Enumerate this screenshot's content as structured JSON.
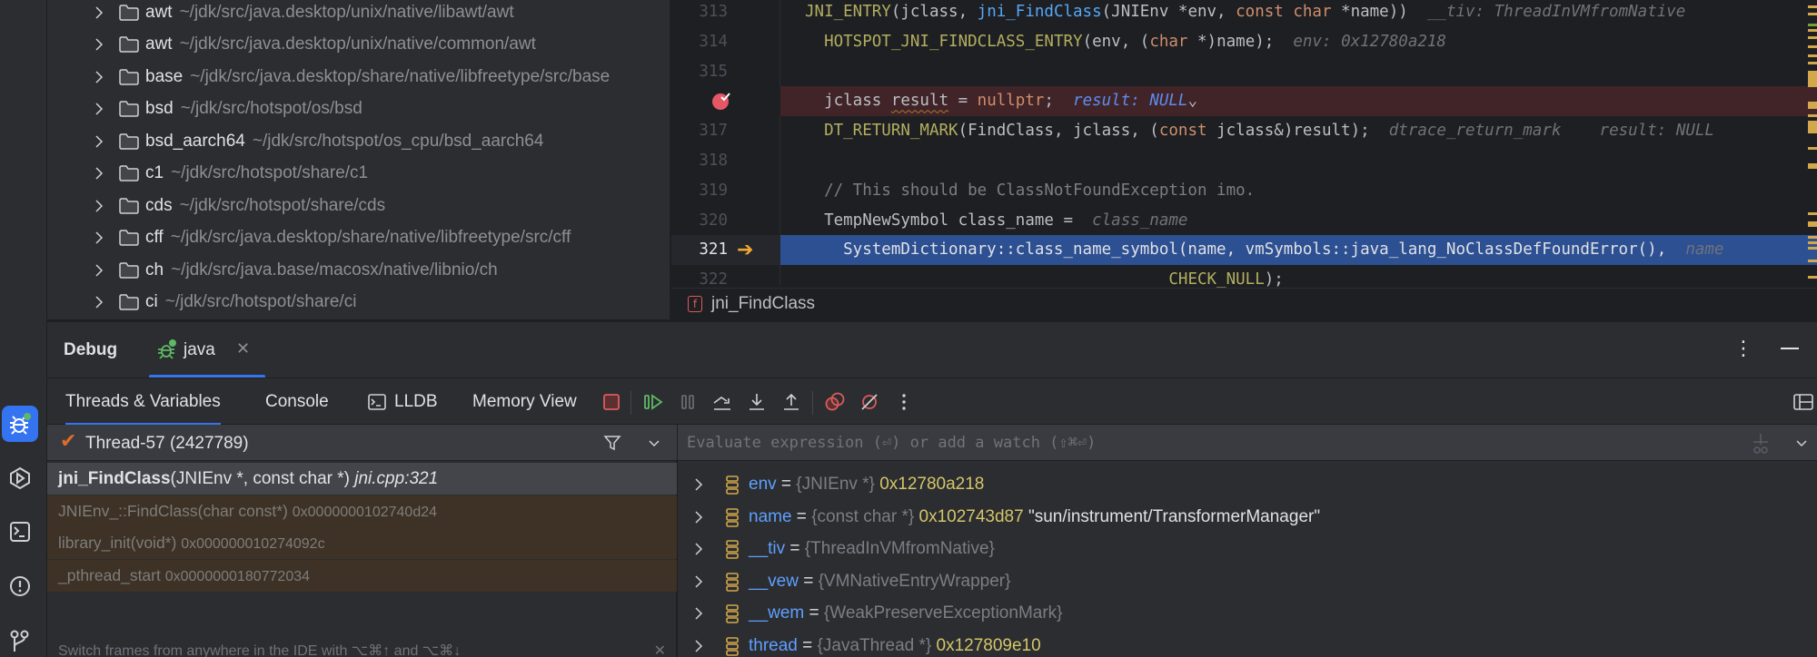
{
  "project_tree": {
    "items": [
      {
        "name": "awt",
        "path": "~/jdk/src/java.desktop/unix/native/libawt/awt"
      },
      {
        "name": "awt",
        "path": "~/jdk/src/java.desktop/unix/native/common/awt"
      },
      {
        "name": "base",
        "path": "~/jdk/src/java.desktop/share/native/libfreetype/src/base"
      },
      {
        "name": "bsd",
        "path": "~/jdk/src/hotspot/os/bsd"
      },
      {
        "name": "bsd_aarch64",
        "path": "~/jdk/src/hotspot/os_cpu/bsd_aarch64"
      },
      {
        "name": "c1",
        "path": "~/jdk/src/hotspot/share/c1"
      },
      {
        "name": "cds",
        "path": "~/jdk/src/hotspot/share/cds"
      },
      {
        "name": "cff",
        "path": "~/jdk/src/java.desktop/share/native/libfreetype/src/cff"
      },
      {
        "name": "ch",
        "path": "~/jdk/src/java.base/macosx/native/libnio/ch"
      },
      {
        "name": "ci",
        "path": "~/jdk/src/hotspot/share/ci"
      }
    ]
  },
  "editor": {
    "lines": [
      {
        "num": "313",
        "parts": [
          [
            "macro",
            "JNI_ENTRY"
          ],
          [
            "plain",
            "(jclass, "
          ],
          [
            "fn",
            "jni_FindClass"
          ],
          [
            "plain",
            "(JNIEnv *env, "
          ],
          [
            "kw",
            "const char"
          ],
          [
            "plain",
            " *name))"
          ],
          [
            "hint",
            "  __tiv: ThreadInVMfromNative"
          ]
        ]
      },
      {
        "num": "314",
        "parts": [
          [
            "plain",
            "  "
          ],
          [
            "macro",
            "HOTSPOT_JNI_FINDCLASS_ENTRY"
          ],
          [
            "plain",
            "(env, ("
          ],
          [
            "kw",
            "char"
          ],
          [
            "plain",
            " *)name);"
          ],
          [
            "hint",
            "  env: 0x12780a218"
          ]
        ]
      },
      {
        "num": "315",
        "parts": []
      },
      {
        "num": "",
        "breakpoint": true,
        "parts": [
          [
            "plain",
            "  jclass "
          ],
          [
            "squiggle",
            "result"
          ],
          [
            "plain",
            " = "
          ],
          [
            "kw",
            "nullptr"
          ],
          [
            "plain",
            ";"
          ],
          [
            "hintblue",
            "  result: NULL"
          ],
          [
            "plain",
            "⌄"
          ]
        ]
      },
      {
        "num": "317",
        "parts": [
          [
            "plain",
            "  "
          ],
          [
            "macro",
            "DT_RETURN_MARK"
          ],
          [
            "plain",
            "(FindClass, jclass, ("
          ],
          [
            "kw",
            "const"
          ],
          [
            "plain",
            " jclass&)result);"
          ],
          [
            "hint",
            "  dtrace_return_mark    result: NULL"
          ]
        ]
      },
      {
        "num": "318",
        "parts": []
      },
      {
        "num": "319",
        "parts": [
          [
            "comment",
            "  // This should be ClassNotFoundException imo."
          ]
        ]
      },
      {
        "num": "320",
        "parts": [
          [
            "plain",
            "  TempNewSymbol class_name = "
          ],
          [
            "hint",
            " class_name"
          ]
        ]
      },
      {
        "num": "321",
        "execution": true,
        "parts": [
          [
            "white",
            "    SystemDictionary::class_name_symbol(name, vmSymbols::java_lang_NoClassDefFoundError(), "
          ],
          [
            "hint",
            " name"
          ]
        ]
      },
      {
        "num": "322",
        "parts": [
          [
            "plain",
            "                                      "
          ],
          [
            "macro",
            "CHECK_NULL"
          ],
          [
            "plain",
            ");"
          ]
        ]
      }
    ],
    "breadcrumb": "jni_FindClass",
    "breadcrumb_badge": "f"
  },
  "debug": {
    "title": "Debug",
    "session_tab": "java",
    "close_glyph": "✕",
    "more_glyph": "⋮",
    "tabs": [
      "Threads & Variables",
      "Console",
      "LLDB",
      "Memory View"
    ],
    "thread": "Thread-57 (2427789)",
    "frames": [
      {
        "func": "jni_FindClass",
        "args": "(JNIEnv *, const char *)",
        "loc": "jni.cpp:321",
        "selected": true
      },
      {
        "func": "JNIEnv_::FindClass(char const*)",
        "addr": "0x0000000102740d24"
      },
      {
        "func": "library_init(void*)",
        "addr": "0x000000010274092c"
      },
      {
        "func": "_pthread_start",
        "addr": "0x0000000180772034"
      }
    ],
    "hint": "Switch frames from anywhere in the IDE with ⌥⌘↑ and ⌥⌘↓",
    "hint_close": "✕",
    "eval_placeholder": "Evaluate expression (⏎) or add a watch (⇧⌘⏎)",
    "variables": [
      {
        "name": "env",
        "type": "{JNIEnv *}",
        "value": "0x12780a218",
        "string": ""
      },
      {
        "name": "name",
        "type": "{const char *}",
        "value": "0x102743d87",
        "string": "\"sun/instrument/TransformerManager\""
      },
      {
        "name": "__tiv",
        "type": "{ThreadInVMfromNative}",
        "value": "",
        "string": ""
      },
      {
        "name": "__vew",
        "type": "{VMNativeEntryWrapper}",
        "value": "",
        "string": ""
      },
      {
        "name": "__wem",
        "type": "{WeakPreserveExceptionMark}",
        "value": "",
        "string": ""
      },
      {
        "name": "thread",
        "type": "{JavaThread *}",
        "value": "0x127809e10",
        "string": ""
      }
    ]
  },
  "colors": {
    "accent": "#3574f0",
    "breakpoint_line": "#402428",
    "execution_line": "#2d5092",
    "library_frame": "#3d3225"
  }
}
